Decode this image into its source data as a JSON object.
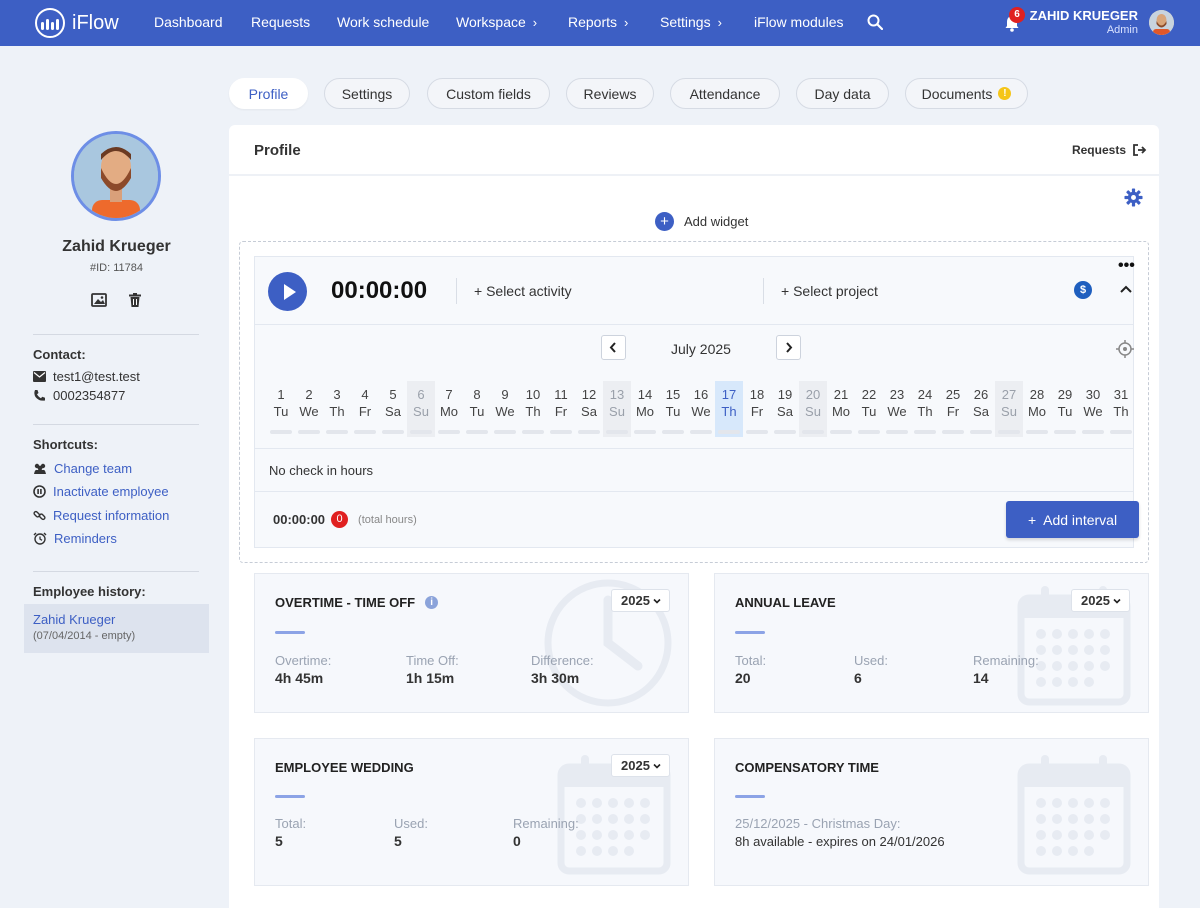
{
  "app": {
    "name": "iFlow"
  },
  "nav": {
    "dashboard": "Dashboard",
    "requests": "Requests",
    "work_schedule": "Work schedule",
    "workspace": "Workspace",
    "reports": "Reports",
    "settings": "Settings",
    "modules": "iFlow modules"
  },
  "user": {
    "name": "ZAHID KRUEGER",
    "role": "Admin",
    "notifications": "6"
  },
  "tabs": [
    "Profile",
    "Settings",
    "Custom fields",
    "Reviews",
    "Attendance",
    "Day data",
    "Documents"
  ],
  "documents_warning": "!",
  "employee": {
    "name": "Zahid Krueger",
    "id": "#ID: 11784"
  },
  "contact": {
    "title": "Contact:",
    "email": "test1@test.test",
    "phone": "0002354877"
  },
  "shortcuts": {
    "title": "Shortcuts:",
    "items": [
      "Change team",
      "Inactivate employee",
      "Request information",
      "Reminders"
    ]
  },
  "history": {
    "title": "Employee history:",
    "name": "Zahid Krueger",
    "date": "(07/04/2014 - empty)"
  },
  "panel": {
    "title": "Profile",
    "requests_link": "Requests",
    "add_widget": "Add widget"
  },
  "tracker": {
    "timer": "00:00:00",
    "select_activity": "+ Select activity",
    "select_project": "+ Select project",
    "currency_icon": "$",
    "month": "July 2025",
    "days": [
      {
        "n": "1",
        "d": "Tu"
      },
      {
        "n": "2",
        "d": "We"
      },
      {
        "n": "3",
        "d": "Th"
      },
      {
        "n": "4",
        "d": "Fr"
      },
      {
        "n": "5",
        "d": "Sa"
      },
      {
        "n": "6",
        "d": "Su"
      },
      {
        "n": "7",
        "d": "Mo"
      },
      {
        "n": "8",
        "d": "Tu"
      },
      {
        "n": "9",
        "d": "We"
      },
      {
        "n": "10",
        "d": "Th"
      },
      {
        "n": "11",
        "d": "Fr"
      },
      {
        "n": "12",
        "d": "Sa"
      },
      {
        "n": "13",
        "d": "Su"
      },
      {
        "n": "14",
        "d": "Mo"
      },
      {
        "n": "15",
        "d": "Tu"
      },
      {
        "n": "16",
        "d": "We"
      },
      {
        "n": "17",
        "d": "Th"
      },
      {
        "n": "18",
        "d": "Fr"
      },
      {
        "n": "19",
        "d": "Sa"
      },
      {
        "n": "20",
        "d": "Su"
      },
      {
        "n": "21",
        "d": "Mo"
      },
      {
        "n": "22",
        "d": "Tu"
      },
      {
        "n": "23",
        "d": "We"
      },
      {
        "n": "24",
        "d": "Th"
      },
      {
        "n": "25",
        "d": "Fr"
      },
      {
        "n": "26",
        "d": "Sa"
      },
      {
        "n": "27",
        "d": "Su"
      },
      {
        "n": "28",
        "d": "Mo"
      },
      {
        "n": "29",
        "d": "Tu"
      },
      {
        "n": "30",
        "d": "We"
      },
      {
        "n": "31",
        "d": "Th"
      }
    ],
    "selected_day": "17",
    "no_check": "No check in hours",
    "total_time": "00:00:00",
    "total_count": "0",
    "total_label": "(total hours)",
    "add_interval": "Add interval"
  },
  "cards": {
    "overtime": {
      "title": "OVERTIME - TIME OFF",
      "year": "2025",
      "info": "i",
      "stats": [
        {
          "label": "Overtime:",
          "value": "4h 45m"
        },
        {
          "label": "Time Off:",
          "value": "1h 15m"
        },
        {
          "label": "Difference:",
          "value": "3h 30m"
        }
      ]
    },
    "annual_leave": {
      "title": "ANNUAL LEAVE",
      "year": "2025",
      "stats": [
        {
          "label": "Total:",
          "value": "20"
        },
        {
          "label": "Used:",
          "value": "6"
        },
        {
          "label": "Remaining:",
          "value": "14"
        }
      ]
    },
    "wedding": {
      "title": "EMPLOYEE WEDDING",
      "year": "2025",
      "stats": [
        {
          "label": "Total:",
          "value": "5"
        },
        {
          "label": "Used:",
          "value": "5"
        },
        {
          "label": "Remaining:",
          "value": "0"
        }
      ]
    },
    "compensatory": {
      "title": "COMPENSATORY TIME",
      "entry_label": "25/12/2025 - Christmas Day:",
      "entry_value": "8h available - expires on 24/01/2026"
    }
  },
  "colors": {
    "primary": "#3d5fc4",
    "badge_red": "#e02020",
    "warning": "#f5c518"
  }
}
